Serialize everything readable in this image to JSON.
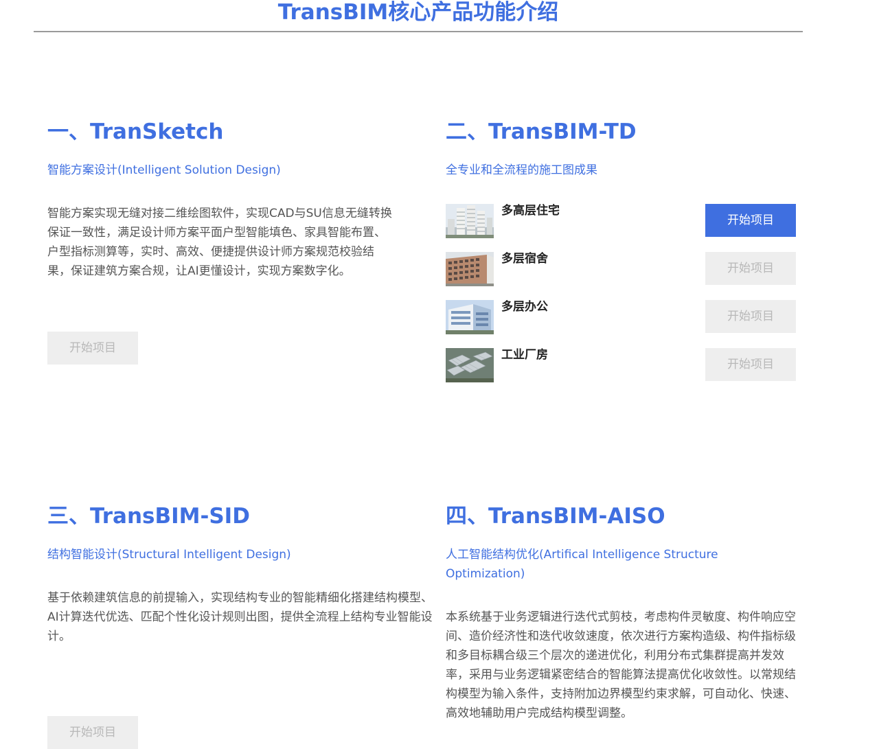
{
  "header": {
    "title": "TransBIM核心产品功能介绍"
  },
  "sections": [
    {
      "heading": "一、TranSketch",
      "subtitle": "智能方案设计(Intelligent Solution Design)",
      "description": "智能方案实现无缝对接二维绘图软件，实现CAD与SU信息无缝转换保证一致性，满足设计师方案平面户型智能填色、家具智能布置、户型指标测算等，实时、高效、便捷提供设计师方案规范校验结果，保证建筑方案合规，让AI更懂设计，实现方案数字化。",
      "button_label": "开始项目"
    },
    {
      "heading": "二、TransBIM-TD",
      "subtitle": "全专业和全流程的施工图成果",
      "types": [
        {
          "label": "多高层住宅",
          "button_label": "开始项目",
          "active": true
        },
        {
          "label": "多层宿舍",
          "button_label": "开始项目",
          "active": false
        },
        {
          "label": "多层办公",
          "button_label": "开始项目",
          "active": false
        },
        {
          "label": "工业厂房",
          "button_label": "开始项目",
          "active": false
        }
      ]
    },
    {
      "heading": "三、TransBIM-SID",
      "subtitle": "结构智能设计(Structural Intelligent Design)",
      "description": "基于依赖建筑信息的前提输入，实现结构专业的智能精细化搭建结构模型、AI计算迭代优选、匹配个性化设计规则出图，提供全流程上结构专业智能设计。",
      "button_label": "开始项目"
    },
    {
      "heading": "四、TransBIM-AISO",
      "subtitle": "人工智能结构优化(Artifical Intelligence Structure Optimization)",
      "description": "本系统基于业务逻辑进行迭代式剪枝，考虑构件灵敏度、构件响应空间、造价经济性和迭代收敛速度，依次进行方案构造级、构件指标级和多目标耦合级三个层次的递进优化，利用分布式集群提高并发效率，采用与业务逻辑紧密结合的智能算法提高优化收敛性。以常规结构模型为输入条件，支持附加边界模型约束求解，可自动化、快速、高效地辅助用户完成结构模型调整。"
    }
  ],
  "colors": {
    "accent": "#3f6fe0",
    "disabled_bg": "#eeeeee",
    "disabled_text": "#b8b8b8",
    "body_text": "#555555"
  }
}
